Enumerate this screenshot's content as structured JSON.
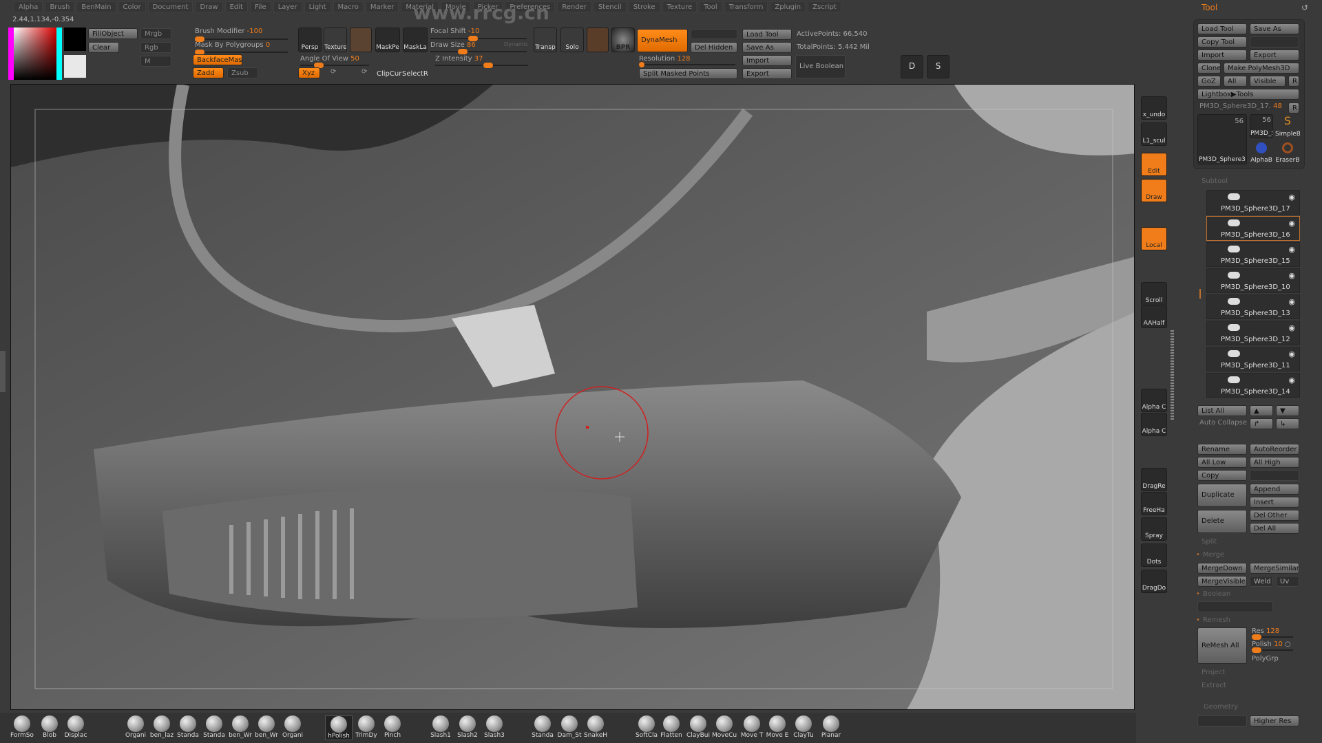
{
  "menu": [
    "Alpha",
    "Brush",
    "BenMain",
    "Color",
    "Document",
    "Draw",
    "Edit",
    "File",
    "Layer",
    "Light",
    "Macro",
    "Marker",
    "Material",
    "Movie",
    "Picker",
    "Preferences",
    "Render",
    "Stencil",
    "Stroke",
    "Texture",
    "Tool",
    "Transform",
    "Zplugin",
    "Zscript"
  ],
  "watermark": "www.rrcg.cn",
  "coords": "2.44,1.134,-0.354",
  "colors": {
    "accent": "#f07d1a",
    "panel": "#3a3a3a",
    "viewport": "#a9a9a9"
  },
  "toolbar": {
    "fill_object": "FillObject",
    "clear": "Clear",
    "mrgb": "Mrgb",
    "rgb": "Rgb",
    "m": "M",
    "brush_modifier": {
      "label": "Brush Modifier",
      "value": "-100"
    },
    "mask_by_polygroups": {
      "label": "Mask By Polygroups",
      "value": "0"
    },
    "backface_mask": "BackfaceMask",
    "zadd": "Zadd",
    "zsub": "Zsub",
    "persp": "Persp",
    "texture": "Texture",
    "mask_pe": "MaskPe",
    "mask_la": "MaskLa",
    "angle_of_view": {
      "label": "Angle Of View",
      "value": "50"
    },
    "xyz": "Xyz",
    "clipcur": "ClipCur",
    "selectr": "SelectR",
    "focal_shift": {
      "label": "Focal Shift",
      "value": "-10"
    },
    "draw_size": {
      "label": "Draw Size",
      "value": "86"
    },
    "dynamic": "Dynamic",
    "z_intensity": {
      "label": "Z Intensity",
      "value": "37"
    },
    "transp": "Transp",
    "solo": "Solo",
    "bpr": "BPR",
    "dynamesh": "DynaMesh",
    "del_hidden": "Del Hidden",
    "resolution": {
      "label": "Resolution",
      "value": "128"
    },
    "split_masked": "Split Masked Points",
    "load_tool": "Load Tool",
    "save_as": "Save As",
    "import": "Import",
    "export": "Export",
    "active_points": "ActivePoints: 66,540",
    "total_points": "TotalPoints: 5.442 Mil",
    "live_boolean": "Live Boolean",
    "d": "D",
    "s": "S"
  },
  "shelf": [
    "x_undo",
    "L1_scul",
    "Edit",
    "Draw",
    "Local",
    "Scroll",
    "AAHalf",
    "Alpha C",
    "Alpha C",
    "DragRe",
    "FreeHa",
    "Spray",
    "Dots",
    "DragDo"
  ],
  "tool": {
    "title": "Tool",
    "load_tool": "Load Tool",
    "save_as": "Save As",
    "copy_tool": "Copy Tool",
    "import": "Import",
    "export": "Export",
    "clone": "Clone",
    "make_polymesh": "Make PolyMesh3D",
    "goz": "GoZ",
    "all": "All",
    "visible": "Visible",
    "r": "R",
    "lightbox": "Lightbox▶Tools",
    "current": "PM3D_Sphere3D_17.",
    "current_value": "48",
    "thumbs": [
      {
        "name": "PM3D_Sphere3",
        "count": "56"
      },
      {
        "name": "PM3D_S",
        "count": "56"
      },
      {
        "name": "SimpleB"
      },
      {
        "name": "AlphaB"
      },
      {
        "name": "EraserB"
      }
    ],
    "subtool_label": "Subtool",
    "subtools": [
      "PM3D_Sphere3D_17",
      "PM3D_Sphere3D_16",
      "PM3D_Sphere3D_15",
      "PM3D_Sphere3D_10",
      "PM3D_Sphere3D_13",
      "PM3D_Sphere3D_12",
      "PM3D_Sphere3D_11",
      "PM3D_Sphere3D_14"
    ],
    "selected_subtool": "PM3D_Sphere3D_16",
    "list_all": "List All",
    "auto_collapse": "Auto Collapse",
    "rename": "Rename",
    "autoreorder": "AutoReorder",
    "all_low": "All Low",
    "all_high": "All High",
    "copy": "Copy",
    "duplicate": "Duplicate",
    "append": "Append",
    "insert": "Insert",
    "delete": "Delete",
    "del_other": "Del Other",
    "del_all": "Del All",
    "split": "Split",
    "merge": "Merge",
    "merge_down": "MergeDown",
    "merge_similar": "MergeSimilar",
    "merge_visible": "MergeVisible",
    "weld": "Weld",
    "uv": "Uv",
    "boolean": "Boolean",
    "remesh": "Remesh",
    "remesh_all": "ReMesh All",
    "res": {
      "label": "Res",
      "value": "128"
    },
    "polish": {
      "label": "Polish",
      "value": "10"
    },
    "polygrp": "PolyGrp",
    "project": "Project",
    "extract": "Extract",
    "geometry": "Geometry",
    "higher_res": "Higher Res"
  },
  "brushes": [
    "FormSo",
    "Blob",
    "Displac",
    "Organi",
    "ben_laz",
    "Standa",
    "Standa",
    "ben_Wr",
    "ben_Wr",
    "Organi",
    "hPolish",
    "TrimDy",
    "Pinch",
    "Slash1",
    "Slash2",
    "Slash3",
    "Standa",
    "Dam_St",
    "SnakeH",
    "SoftCla",
    "Flatten",
    "ClayBui",
    "MoveCu",
    "Move T",
    "Move E",
    "ClayTu",
    "Planar"
  ],
  "active_brush": "hPolish"
}
